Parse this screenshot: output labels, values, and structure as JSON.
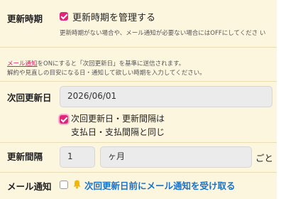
{
  "update_period": {
    "label": "更新時期",
    "manage_checkbox_label": "更新時期を管理する",
    "manage_checked": true,
    "hint": "更新時期がない場合や、メール通知が必要ない場合にはOFFにしてくださ い"
  },
  "info": {
    "mail_link": "メール通知",
    "line1_rest": "をONにすると「次回更新日」を基準に送信されます。",
    "line2": "解約や見直しの目安になる日・通知して欲しい時期を入力してください。"
  },
  "next_update": {
    "label": "次回更新日",
    "date_value": "2026/06/01",
    "same_checkbox_line1": "次回更新日・更新間隔は",
    "same_checkbox_line2": "支払日・支払間隔と同じ",
    "same_checked": true
  },
  "interval": {
    "label": "更新間隔",
    "number_value": "1",
    "unit_value": "ヶ月",
    "suffix": "ごと"
  },
  "mail_notify": {
    "label": "メール通知",
    "checked": false,
    "option_label": "次回更新日前にメール通知を受け取る",
    "icon": "bell-icon",
    "color": "#1a73c8"
  }
}
